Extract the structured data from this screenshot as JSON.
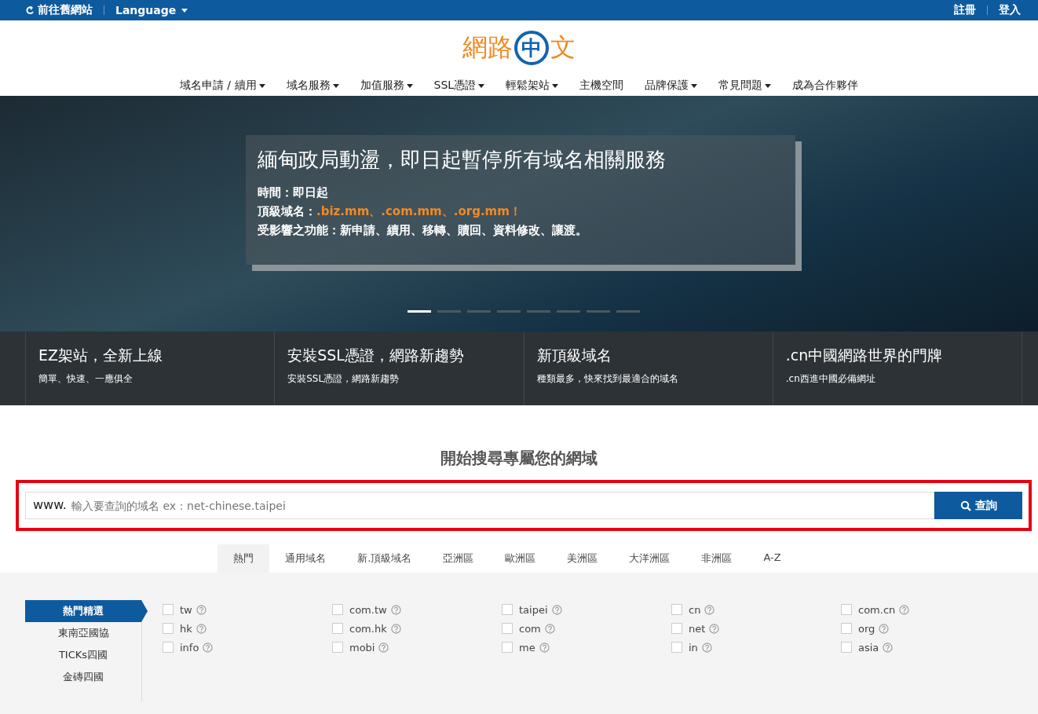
{
  "top_bar": {
    "left": [
      {
        "kind": "back",
        "label": "前往舊網站"
      },
      {
        "kind": "dropdown",
        "label": "Language"
      }
    ],
    "right": [
      "註冊",
      "登入"
    ]
  },
  "logo": {
    "left": "網路",
    "circle": "中",
    "right": "文"
  },
  "nav": [
    {
      "label": "域名申請 / 續用",
      "dropdown": true
    },
    {
      "label": "域名服務",
      "dropdown": true
    },
    {
      "label": "加值服務",
      "dropdown": true
    },
    {
      "label": "SSL憑證",
      "dropdown": true
    },
    {
      "label": "輕鬆架站",
      "dropdown": true
    },
    {
      "label": "主機空間",
      "dropdown": false
    },
    {
      "label": "品牌保護",
      "dropdown": true
    },
    {
      "label": "常見問題",
      "dropdown": true
    },
    {
      "label": "成為合作夥伴",
      "dropdown": false
    }
  ],
  "hero": {
    "title": "緬甸政局動盪，即日起暫停所有域名相關服務",
    "lines": [
      "時間：即日起",
      "頂級域名：**.biz.mm、.com.mm、.org.mm！**",
      "受影響之功能：新申請、續用、移轉、贖回、資料修改、讓渡。"
    ],
    "dots": [
      {
        "selected": true
      },
      {
        "selected": false
      },
      {
        "selected": false
      },
      {
        "selected": false
      },
      {
        "selected": false
      },
      {
        "selected": false
      },
      {
        "selected": false
      },
      {
        "selected": false
      }
    ]
  },
  "features": [
    {
      "title": "EZ架站，全新上線",
      "subtitle": "簡單、快速、一應俱全"
    },
    {
      "title": "安裝SSL憑證，網路新趨勢",
      "subtitle": "安裝SSL憑證，網路新趨勢"
    },
    {
      "title": "新頂級域名",
      "subtitle": "種類最多，快來找到最適合的域名"
    },
    {
      "title": ".cn中國網路世界的門牌",
      "subtitle": ".cn西進中國必備網址"
    }
  ],
  "search": {
    "heading": "開始搜尋專屬您的網域",
    "prefix": "www.",
    "placeholder": "輸入要查詢的域名 ex：net-chinese.taipei",
    "button": "查詢"
  },
  "tabs": [
    {
      "label": "熱門",
      "selected": true
    },
    {
      "label": "通用域名",
      "selected": false
    },
    {
      "label": "新.頂級域名",
      "selected": false
    },
    {
      "label": "亞洲區",
      "selected": false
    },
    {
      "label": "歐洲區",
      "selected": false
    },
    {
      "label": "美洲區",
      "selected": false
    },
    {
      "label": "大洋洲區",
      "selected": false
    },
    {
      "label": "非洲區",
      "selected": false
    },
    {
      "label": "A-Z",
      "selected": false
    }
  ],
  "sidebar": [
    {
      "label": "熱門精選",
      "selected": true
    },
    {
      "label": "東南亞國協",
      "selected": false
    },
    {
      "label": "TICKs四國",
      "selected": false
    },
    {
      "label": "金磚四國",
      "selected": false
    }
  ],
  "domains": [
    {
      "name": "tw",
      "checked": false
    },
    {
      "name": "com.tw",
      "checked": false
    },
    {
      "name": "taipei",
      "checked": false
    },
    {
      "name": "cn",
      "checked": false
    },
    {
      "name": "com.cn",
      "checked": false
    },
    {
      "name": "hk",
      "checked": false
    },
    {
      "name": "com.hk",
      "checked": false
    },
    {
      "name": "com",
      "checked": false
    },
    {
      "name": "net",
      "checked": false
    },
    {
      "name": "org",
      "checked": false
    },
    {
      "name": "info",
      "checked": false
    },
    {
      "name": "mobi",
      "checked": false
    },
    {
      "name": "me",
      "checked": false
    },
    {
      "name": "in",
      "checked": false
    },
    {
      "name": "asia",
      "checked": false
    }
  ]
}
